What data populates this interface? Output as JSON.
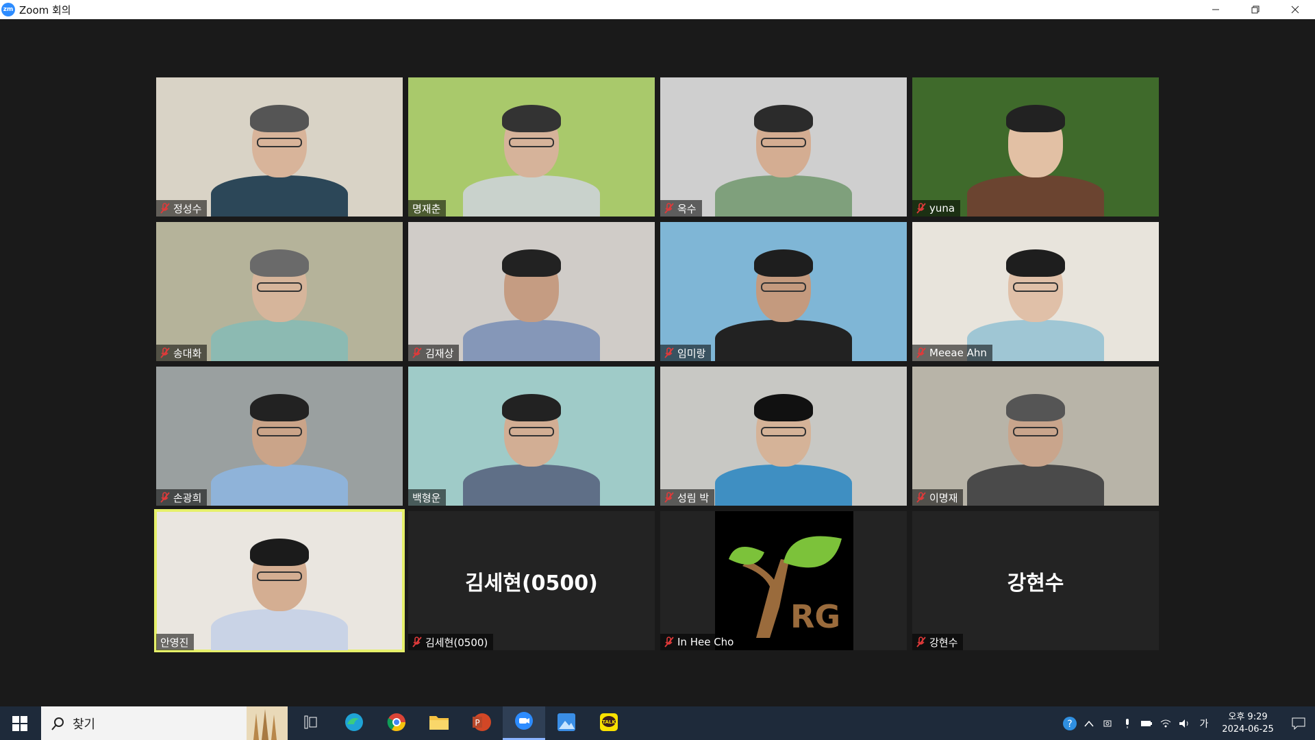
{
  "window": {
    "title": "Zoom 회의",
    "app_logo": "zm"
  },
  "participants": [
    {
      "name": "정성수",
      "muted": true,
      "bg": "#d9d3c6",
      "skin": "#d8b49a",
      "shirt": "#2c4758",
      "hair": "#555555",
      "glasses": true
    },
    {
      "name": "명재춘",
      "muted": false,
      "bg": "#a9c96b",
      "skin": "#d6b39a",
      "shirt": "#c9d2cc",
      "hair": "#333333",
      "glasses": true
    },
    {
      "name": "옥수",
      "muted": true,
      "bg": "#cfcfcf",
      "skin": "#d4ad92",
      "shirt": "#7fa07c",
      "hair": "#2b2b2b",
      "glasses": true
    },
    {
      "name": "yuna",
      "muted": true,
      "bg": "#3f6a2b",
      "skin": "#e2c0a4",
      "shirt": "#6b4430",
      "hair": "#222222",
      "glasses": false
    },
    {
      "name": "송대화",
      "muted": true,
      "bg": "#b5b39a",
      "skin": "#d6b59b",
      "shirt": "#8cbab2",
      "hair": "#6a6a6a",
      "glasses": true
    },
    {
      "name": "김재상",
      "muted": true,
      "bg": "#d0ccc8",
      "skin": "#c59c82",
      "shirt": "#8597b8",
      "hair": "#222222",
      "glasses": false
    },
    {
      "name": "임미랑",
      "muted": true,
      "bg": "#7fb6d6",
      "skin": "#c49a7e",
      "shirt": "#222222",
      "hair": "#1e1e1e",
      "glasses": true
    },
    {
      "name": "Meeae Ahn",
      "muted": true,
      "bg": "#e8e4dc",
      "skin": "#e0c0a8",
      "shirt": "#9fc6d4",
      "hair": "#1e1e1e",
      "glasses": true
    },
    {
      "name": "손광희",
      "muted": true,
      "bg": "#9aa0a0",
      "skin": "#caa489",
      "shirt": "#8fb3d9",
      "hair": "#222222",
      "glasses": true
    },
    {
      "name": "백형운",
      "muted": false,
      "bg": "#9fcbc8",
      "skin": "#d2ae94",
      "shirt": "#5f6f87",
      "hair": "#222222",
      "glasses": true
    },
    {
      "name": "성림 박",
      "muted": true,
      "bg": "#c8c8c4",
      "skin": "#d5b398",
      "shirt": "#3f8fc2",
      "hair": "#111111",
      "glasses": true
    },
    {
      "name": "이명재",
      "muted": true,
      "bg": "#b8b4a8",
      "skin": "#c9a58c",
      "shirt": "#4a4a4a",
      "hair": "#555555",
      "glasses": true
    },
    {
      "name": "안영진",
      "muted": false,
      "active": true,
      "bg": "#eae6e0",
      "skin": "#d4ae92",
      "shirt": "#c9d3e6",
      "hair": "#1b1b1b",
      "glasses": true
    },
    {
      "name": "김세현(0500)",
      "muted": true,
      "video": false,
      "display_name": "김세현(0500)"
    },
    {
      "name": "In Hee Cho",
      "muted": true,
      "video": false,
      "logo": true,
      "logo_text": "RG",
      "logo_leaf": "#7cc23a",
      "logo_trunk": "#9a6b3c"
    },
    {
      "name": "강현수",
      "muted": true,
      "video": false,
      "display_name": "강현수"
    }
  ],
  "taskbar": {
    "search_text": "찾기",
    "apps": [
      "task-view-icon",
      "edge-icon",
      "chrome-icon",
      "file-explorer-icon",
      "powerpoint-icon",
      "zoom-icon",
      "photos-icon",
      "kakaotalk-icon"
    ],
    "active_app": "zoom-icon",
    "kakao_label": "TALK",
    "ime": "가",
    "time": "오후 9:29",
    "date": "2024-06-25"
  },
  "colors": {
    "active_speaker": "#e6f06a",
    "mute": "#e03a3a",
    "meeting_bg": "#1a1a1a",
    "taskbar_bg": "#1e2a3a"
  }
}
